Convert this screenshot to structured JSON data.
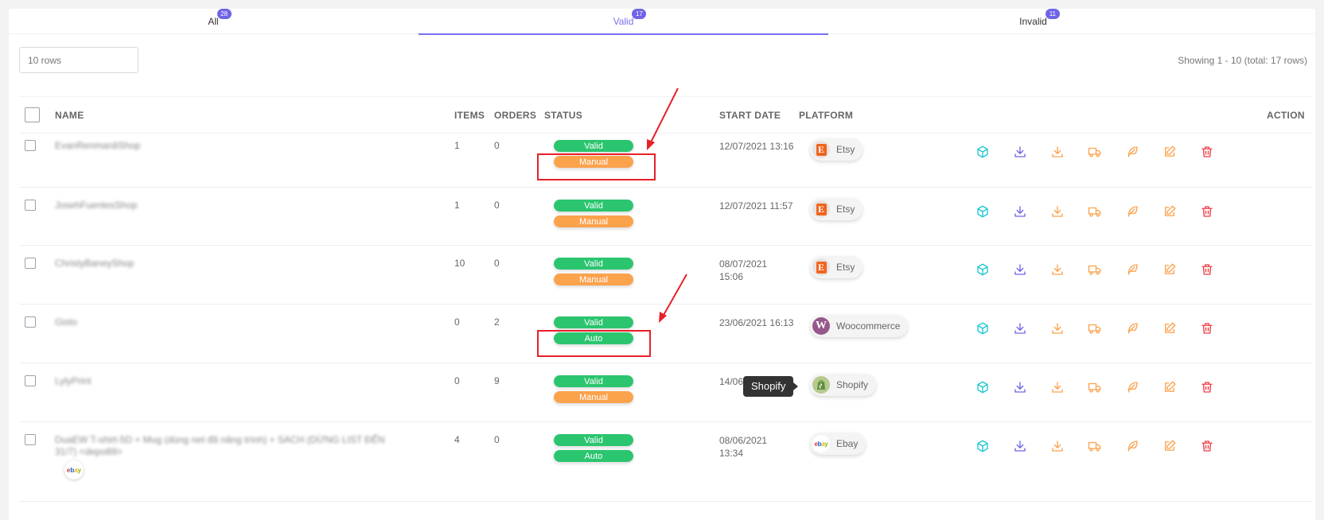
{
  "tabs": [
    {
      "label": "All",
      "count": "28"
    },
    {
      "label": "Valid",
      "count": "17"
    },
    {
      "label": "Invalid",
      "count": "11"
    }
  ],
  "rows_select": {
    "value": "10 rows"
  },
  "showing": "Showing 1 - 10 (total: 17 rows)",
  "headers": {
    "name": "NAME",
    "items": "ITEMS",
    "orders": "ORDERS",
    "status": "STATUS",
    "start_date": "START DATE",
    "platform": "PLATFORM",
    "action": "ACTION"
  },
  "rows": [
    {
      "name": "EvanRenmardiShop",
      "items": "1",
      "orders": "0",
      "status": "Valid",
      "mode": "Manual",
      "date": "12/07/2021 13:16",
      "platform": "Etsy"
    },
    {
      "name": "JosehFuentesShop",
      "items": "1",
      "orders": "0",
      "status": "Valid",
      "mode": "Manual",
      "date": "12/07/2021 11:57",
      "platform": "Etsy"
    },
    {
      "name": "ChristyBaneyShop",
      "items": "10",
      "orders": "0",
      "status": "Valid",
      "mode": "Manual",
      "date": "08/07/2021 15:06",
      "platform": "Etsy"
    },
    {
      "name": "Gisto",
      "items": "0",
      "orders": "2",
      "status": "Valid",
      "mode": "Auto",
      "date": "23/06/2021 16:13",
      "platform": "Woocommerce"
    },
    {
      "name": "LylyPrint",
      "items": "0",
      "orders": "9",
      "status": "Valid",
      "mode": "Manual",
      "date": "14/06/",
      "platform": "Shopify"
    },
    {
      "name": "DuaEW T-shirt-5D + Mug (dùng net đã nâng trình) + SACH (DỪNG LIST ĐẾN 31/7) <depo89>",
      "items": "4",
      "orders": "0",
      "status": "Valid",
      "mode": "Auto",
      "date": "08/06/2021 13:34",
      "platform": "Ebay"
    }
  ],
  "logos": {
    "etsy": "E",
    "woo": "W",
    "ebay": [
      "e",
      "b",
      "a",
      "y"
    ]
  },
  "tooltip": "Shopify",
  "colors": {
    "accent": "#7a6ff0",
    "valid": "#2cc56f",
    "manual": "#fba24d",
    "annotation": "#e8202a"
  }
}
